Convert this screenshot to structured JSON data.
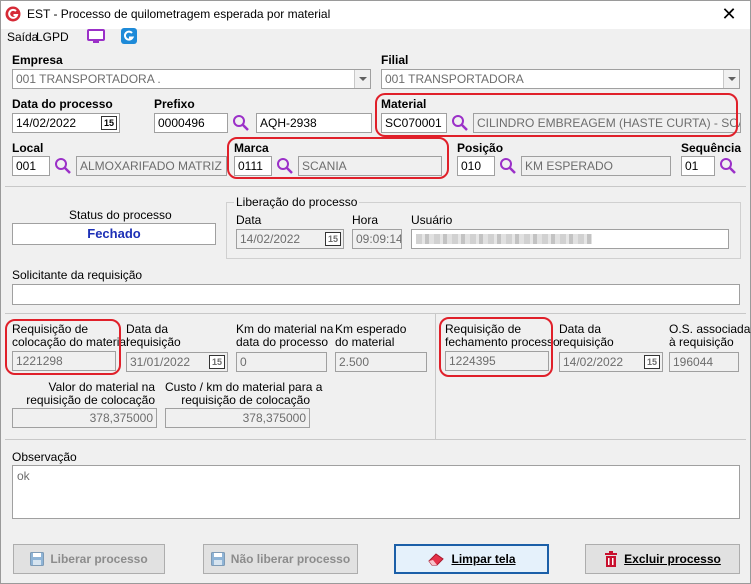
{
  "window": {
    "title": "EST - Processo de quilometragem esperada por material",
    "close_glyph": "✕"
  },
  "menu": {
    "saida": "Saída",
    "lgpd": "LGPD"
  },
  "empresa": {
    "label": "Empresa",
    "value": "001 TRANSPORTADORA ."
  },
  "filial": {
    "label": "Filial",
    "value": "001 TRANSPORTADORA"
  },
  "data_processo": {
    "label": "Data do processo",
    "value": "14/02/2022"
  },
  "prefixo": {
    "label": "Prefixo",
    "code": "0000496",
    "plate": "AQH-2938"
  },
  "material": {
    "label": "Material",
    "code": "SC070001",
    "description": "CILINDRO EMBREAGEM (HASTE CURTA) - SCANIA"
  },
  "local": {
    "label": "Local",
    "code": "001",
    "description": "ALMOXARIFADO MATRIZ"
  },
  "marca": {
    "label": "Marca",
    "code": "0111",
    "description": "SCANIA"
  },
  "posicao": {
    "label": "Posição",
    "code": "010",
    "description": "KM ESPERADO"
  },
  "sequencia": {
    "label": "Sequência",
    "value": "01"
  },
  "status": {
    "label": "Status do processo",
    "value": "Fechado"
  },
  "liberacao": {
    "group_label": "Liberação do processo",
    "data_label": "Data",
    "data_value": "14/02/2022",
    "hora_label": "Hora",
    "hora_value": "09:09:14",
    "usuario_label": "Usuário"
  },
  "solicitante": {
    "label": "Solicitante da requisição",
    "value": ""
  },
  "req_colocacao": {
    "label_l1": "Requisição de",
    "label_l2": "colocação do material",
    "value": "1221298"
  },
  "data_requisicao_1": {
    "label_l1": "Data da",
    "label_l2": "requisição",
    "value": "31/01/2022"
  },
  "km_material": {
    "label_l1": "Km do material na",
    "label_l2": "data do processo",
    "value": "0"
  },
  "km_esperado": {
    "label_l1": "Km esperado",
    "label_l2": "do material",
    "value": "2.500"
  },
  "req_fechamento": {
    "label_l1": "Requisição de",
    "label_l2": "fechamento processo",
    "value": "1224395"
  },
  "data_requisicao_2": {
    "label_l1": "Data da",
    "label_l2": "requisição",
    "value": "14/02/2022"
  },
  "os_associada": {
    "label_l1": "O.S. associada",
    "label_l2": "à requisição",
    "value": "196044"
  },
  "valor_material": {
    "label_l1": "Valor do material na",
    "label_l2": "requisição de colocação",
    "value": "378,375000"
  },
  "custo_km": {
    "label_l1": "Custo / km do material para a",
    "label_l2": "requisição de colocação",
    "value": "378,375000"
  },
  "observacao": {
    "label": "Observação",
    "value": "ok"
  },
  "buttons": {
    "liberar": "Liberar processo",
    "nao_liberar": "Não liberar processo",
    "limpar": "Limpar tela",
    "excluir": "Excluir processo"
  },
  "calendar_glyph": "15",
  "colors": {
    "highlight_red": "#e0202a",
    "status_blue": "#1c2fb6",
    "search_purple": "#9b30c8",
    "logo_red": "#d62a36"
  },
  "icons": [
    "app-logo-icon",
    "monitor-icon",
    "g-app-icon",
    "magnifier-icon",
    "calendar-icon",
    "save-disk-icon",
    "eraser-icon",
    "trash-icon",
    "combo-arrow-icon"
  ]
}
